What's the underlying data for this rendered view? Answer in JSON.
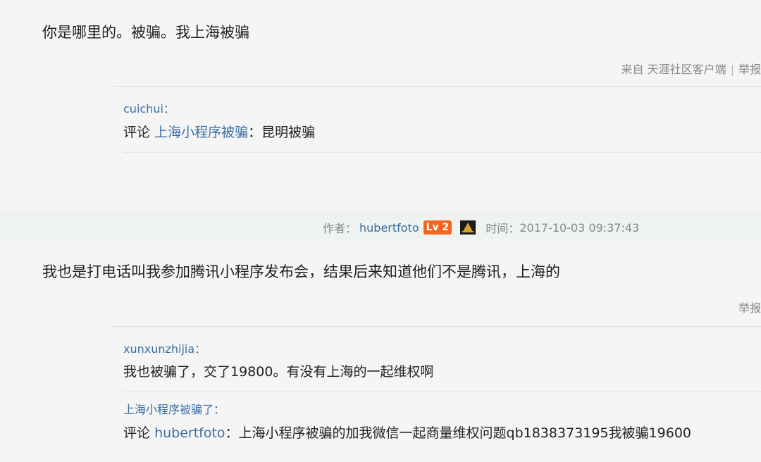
{
  "post1": {
    "body": "你是哪里的。被骗。我上海被骗",
    "source_text": "来自 天涯社区客户端",
    "sep": "|",
    "report_label": "举报"
  },
  "post1_comment": {
    "author": "cuichui：",
    "prefix": "评论",
    "target": "上海小程序被骗",
    "text": "：昆明被骗"
  },
  "author_bar": {
    "author_label": "作者：",
    "author_name": "hubertfoto",
    "level_badge": "Lv 2",
    "time_label": "时间：",
    "time_value": "2017-10-03 09:37:43"
  },
  "post2": {
    "body": "我也是打电话叫我参加腾讯小程序发布会，结果后来知道他们不是腾讯，上海的",
    "report_label": "举报"
  },
  "post2_comments": [
    {
      "author": "xunxunzhijia：",
      "text": "我也被骗了，交了19800。有没有上海的一起维权啊"
    },
    {
      "author": "上海小程序被骗了：",
      "prefix": "评论",
      "target": "hubertfoto",
      "text": "：上海小程序被骗的加我微信一起商量维权问题qb1838373195我被骗19600"
    }
  ]
}
